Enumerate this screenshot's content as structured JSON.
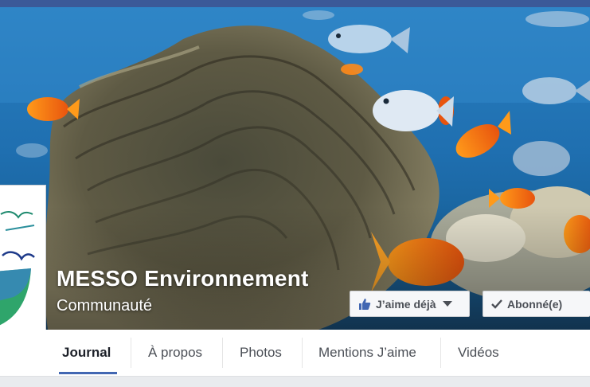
{
  "page": {
    "name": "MESSO Environnement",
    "category": "Communauté"
  },
  "actions": {
    "like_label": "J’aime déjà",
    "follow_label": "Abonné(e)"
  },
  "tabs": [
    {
      "label": "Journal",
      "active": true
    },
    {
      "label": "À propos",
      "active": false
    },
    {
      "label": "Photos",
      "active": false
    },
    {
      "label": "Mentions J’aime",
      "active": false
    },
    {
      "label": "Vidéos",
      "active": false
    }
  ],
  "colors": {
    "brand_blue": "#3b5998",
    "active_tab_underline": "#4267b2"
  },
  "icons": {
    "like": "thumbs-up-icon",
    "follow": "checkmark-icon",
    "dropdown": "caret-down-icon"
  }
}
